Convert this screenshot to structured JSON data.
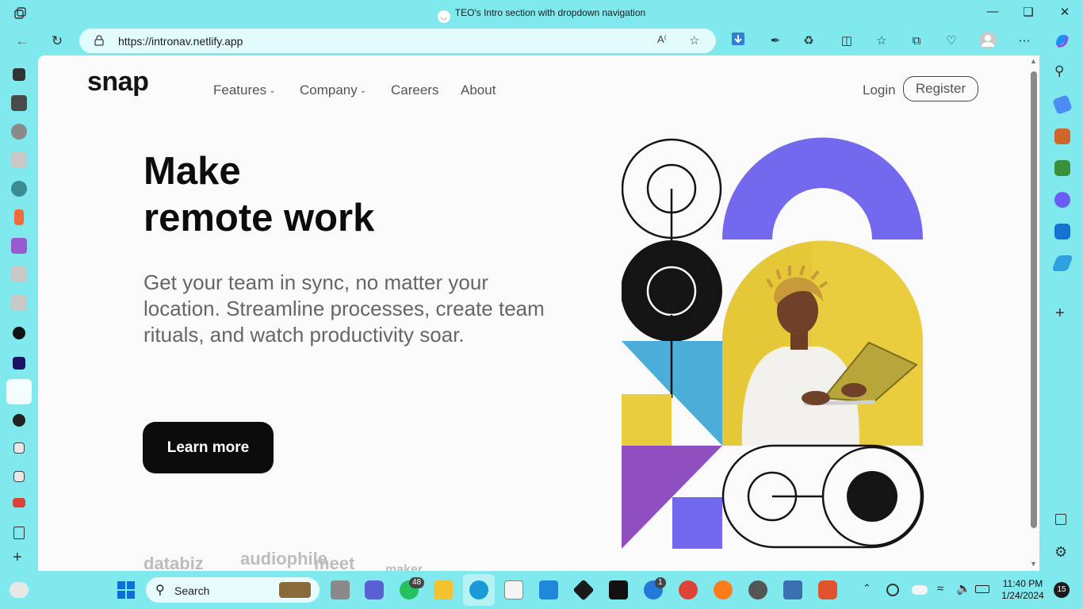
{
  "browser": {
    "tab_title": "TEO's Intro section with dropdown navigation",
    "url": "https://intronav.netlify.app"
  },
  "site": {
    "logo": "snap",
    "nav": {
      "features": "Features",
      "company": "Company",
      "careers": "Careers",
      "about": "About",
      "login": "Login",
      "register": "Register"
    },
    "hero": {
      "title_line1": "Make",
      "title_line2": "remote work",
      "description": "Get your team in sync, no matter your location. Streamline processes, create team rituals, and watch productivity soar.",
      "cta": "Learn more"
    },
    "clients": [
      "databiz",
      "audiophile",
      "meet",
      "maker"
    ]
  },
  "taskbar": {
    "search_label": "Search",
    "whatsapp_badge": "48",
    "app_badge": "1",
    "time": "11:40 PM",
    "date": "1/24/2024",
    "notifications": "15"
  },
  "colors": {
    "chrome": "#7fe9ee",
    "page_bg": "#fafafa",
    "purple": "#7369ef",
    "yellow": "#e9cd3f",
    "blue": "#4aaed9",
    "violet": "#8f4fc0",
    "black": "#141414"
  }
}
